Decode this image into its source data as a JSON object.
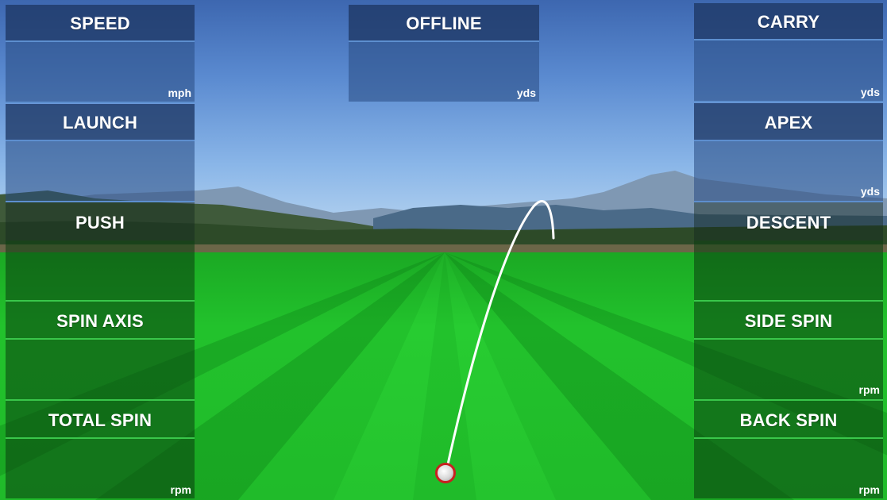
{
  "left_panel": {
    "tiles": [
      {
        "title": "SPEED",
        "unit": "mph"
      },
      {
        "title": "LAUNCH",
        "unit": ""
      },
      {
        "title": "PUSH",
        "unit": ""
      },
      {
        "title": "SPIN AXIS",
        "unit": ""
      },
      {
        "title": "TOTAL SPIN",
        "unit": "rpm"
      }
    ]
  },
  "center_panel": {
    "tiles": [
      {
        "title": "OFFLINE",
        "unit": "yds"
      }
    ]
  },
  "right_panel": {
    "tiles": [
      {
        "title": "CARRY",
        "unit": "yds"
      },
      {
        "title": "APEX",
        "unit": "yds"
      },
      {
        "title": "DESCENT",
        "unit": ""
      },
      {
        "title": "SIDE SPIN",
        "unit": "rpm"
      },
      {
        "title": "BACK SPIN",
        "unit": "rpm"
      }
    ]
  },
  "colors": {
    "tile_header_blue": "#1e3764",
    "divider_blue": "#5d8fcf",
    "divider_green": "#39c64a",
    "ball_ring": "#c92020",
    "trajectory": "#ffffff"
  },
  "icons": {
    "ball": "golf-ball-icon",
    "trajectory": "ball-trajectory"
  }
}
